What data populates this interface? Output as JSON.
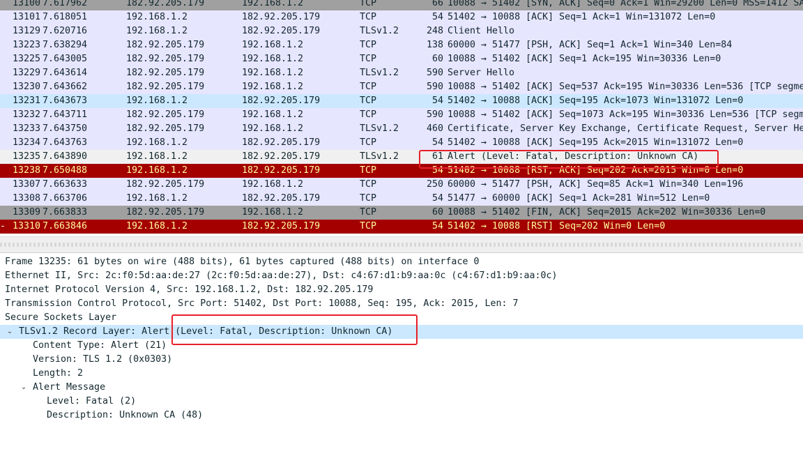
{
  "colors": {
    "sel_bg": "#cce8ff",
    "highlight_box": "#e8202a"
  },
  "packets": [
    {
      "no": "13100",
      "time": "7.617962",
      "src": "182.92.205.179",
      "dst": "192.168.1.2",
      "proto": "TCP",
      "len": "66",
      "info": "10088 → 51402 [SYN, ACK] Seq=0 Ack=1 Win=29200 Len=0 MSS=1412 SA",
      "bg": "#a0a0a0",
      "fg": "#12272e"
    },
    {
      "no": "13101",
      "time": "7.618051",
      "src": "192.168.1.2",
      "dst": "182.92.205.179",
      "proto": "TCP",
      "len": "54",
      "info": "51402 → 10088 [ACK] Seq=1 Ack=1 Win=131072 Len=0",
      "bg": "#e7e6ff",
      "fg": "#12272e"
    },
    {
      "no": "13129",
      "time": "7.620716",
      "src": "192.168.1.2",
      "dst": "182.92.205.179",
      "proto": "TLSv1.2",
      "len": "248",
      "info": "Client Hello",
      "bg": "#e7e6ff",
      "fg": "#12272e"
    },
    {
      "no": "13223",
      "time": "7.638294",
      "src": "182.92.205.179",
      "dst": "192.168.1.2",
      "proto": "TCP",
      "len": "138",
      "info": "60000 → 51477 [PSH, ACK] Seq=1 Ack=1 Win=340 Len=84",
      "bg": "#e7e6ff",
      "fg": "#12272e"
    },
    {
      "no": "13225",
      "time": "7.643005",
      "src": "182.92.205.179",
      "dst": "192.168.1.2",
      "proto": "TCP",
      "len": "60",
      "info": "10088 → 51402 [ACK] Seq=1 Ack=195 Win=30336 Len=0",
      "bg": "#e7e6ff",
      "fg": "#12272e"
    },
    {
      "no": "13229",
      "time": "7.643614",
      "src": "182.92.205.179",
      "dst": "192.168.1.2",
      "proto": "TLSv1.2",
      "len": "590",
      "info": "Server Hello",
      "bg": "#e7e6ff",
      "fg": "#12272e"
    },
    {
      "no": "13230",
      "time": "7.643662",
      "src": "182.92.205.179",
      "dst": "192.168.1.2",
      "proto": "TCP",
      "len": "590",
      "info": "10088 → 51402 [ACK] Seq=537 Ack=195 Win=30336 Len=536 [TCP segme",
      "bg": "#e7e6ff",
      "fg": "#12272e"
    },
    {
      "no": "13231",
      "time": "7.643673",
      "src": "192.168.1.2",
      "dst": "182.92.205.179",
      "proto": "TCP",
      "len": "54",
      "info": "51402 → 10088 [ACK] Seq=195 Ack=1073 Win=131072 Len=0",
      "bg": "#cce8ff",
      "fg": "#12272e"
    },
    {
      "no": "13232",
      "time": "7.643711",
      "src": "182.92.205.179",
      "dst": "192.168.1.2",
      "proto": "TCP",
      "len": "590",
      "info": "10088 → 51402 [ACK] Seq=1073 Ack=195 Win=30336 Len=536 [TCP segm",
      "bg": "#e7e6ff",
      "fg": "#12272e"
    },
    {
      "no": "13233",
      "time": "7.643750",
      "src": "182.92.205.179",
      "dst": "192.168.1.2",
      "proto": "TLSv1.2",
      "len": "460",
      "info": "Certificate, Server Key Exchange, Certificate Request, Server He",
      "bg": "#e7e6ff",
      "fg": "#12272e"
    },
    {
      "no": "13234",
      "time": "7.643763",
      "src": "192.168.1.2",
      "dst": "182.92.205.179",
      "proto": "TCP",
      "len": "54",
      "info": "51402 → 10088 [ACK] Seq=195 Ack=2015 Win=131072 Len=0",
      "bg": "#e7e6ff",
      "fg": "#12272e"
    },
    {
      "no": "13235",
      "time": "7.643890",
      "src": "192.168.1.2",
      "dst": "182.92.205.179",
      "proto": "TLSv1.2",
      "len": "61",
      "info": "Alert (Level: Fatal, Description: Unknown CA)",
      "bg": "#f0f0f0",
      "fg": "#12272e"
    },
    {
      "no": "13238",
      "time": "7.650488",
      "src": "192.168.1.2",
      "dst": "182.92.205.179",
      "proto": "TCP",
      "len": "54",
      "info": "51402 → 10088 [RST, ACK] Seq=202 Ack=2015 Win=0 Len=0",
      "bg": "#a40000",
      "fg": "#fffc9c"
    },
    {
      "no": "13307",
      "time": "7.663633",
      "src": "182.92.205.179",
      "dst": "192.168.1.2",
      "proto": "TCP",
      "len": "250",
      "info": "60000 → 51477 [PSH, ACK] Seq=85 Ack=1 Win=340 Len=196",
      "bg": "#e7e6ff",
      "fg": "#12272e"
    },
    {
      "no": "13308",
      "time": "7.663706",
      "src": "192.168.1.2",
      "dst": "182.92.205.179",
      "proto": "TCP",
      "len": "54",
      "info": "51477 → 60000 [ACK] Seq=1 Ack=281 Win=512 Len=0",
      "bg": "#e7e6ff",
      "fg": "#12272e"
    },
    {
      "no": "13309",
      "time": "7.663833",
      "src": "182.92.205.179",
      "dst": "192.168.1.2",
      "proto": "TCP",
      "len": "60",
      "info": "10088 → 51402 [FIN, ACK] Seq=2015 Ack=202 Win=30336 Len=0",
      "bg": "#a0a0a0",
      "fg": "#12272e"
    },
    {
      "no": "13310",
      "time": "7.663846",
      "src": "192.168.1.2",
      "dst": "182.92.205.179",
      "proto": "TCP",
      "len": "54",
      "info": "51402 → 10088 [RST] Seq=202 Win=0 Len=0",
      "bg": "#a40000",
      "fg": "#fffc9c",
      "marker": "-"
    }
  ],
  "details": [
    {
      "indent": 0,
      "toggle": "",
      "text": "Frame 13235: 61 bytes on wire (488 bits), 61 bytes captured (488 bits) on interface 0",
      "selected": false
    },
    {
      "indent": 0,
      "toggle": "",
      "text": "Ethernet II, Src: 2c:f0:5d:aa:de:27 (2c:f0:5d:aa:de:27), Dst: c4:67:d1:b9:aa:0c (c4:67:d1:b9:aa:0c)",
      "selected": false
    },
    {
      "indent": 0,
      "toggle": "",
      "text": "Internet Protocol Version 4, Src: 192.168.1.2, Dst: 182.92.205.179",
      "selected": false
    },
    {
      "indent": 0,
      "toggle": "",
      "text": "Transmission Control Protocol, Src Port: 51402, Dst Port: 10088, Seq: 195, Ack: 2015, Len: 7",
      "selected": false
    },
    {
      "indent": 0,
      "toggle": "",
      "text": "Secure Sockets Layer",
      "selected": false
    },
    {
      "indent": 1,
      "toggle": "⌄",
      "text": "TLSv1.2 Record Layer: Alert (Level: Fatal, Description: Unknown CA)",
      "selected": true
    },
    {
      "indent": 2,
      "toggle": "",
      "text": "Content Type: Alert (21)",
      "selected": false
    },
    {
      "indent": 2,
      "toggle": "",
      "text": "Version: TLS 1.2 (0x0303)",
      "selected": false
    },
    {
      "indent": 2,
      "toggle": "",
      "text": "Length: 2",
      "selected": false
    },
    {
      "indent": 2,
      "toggle": "⌄",
      "text": "Alert Message",
      "selected": false
    },
    {
      "indent": 3,
      "toggle": "",
      "text": "Level: Fatal (2)",
      "selected": false
    },
    {
      "indent": 3,
      "toggle": "",
      "text": "Description: Unknown CA (48)",
      "selected": false
    }
  ]
}
